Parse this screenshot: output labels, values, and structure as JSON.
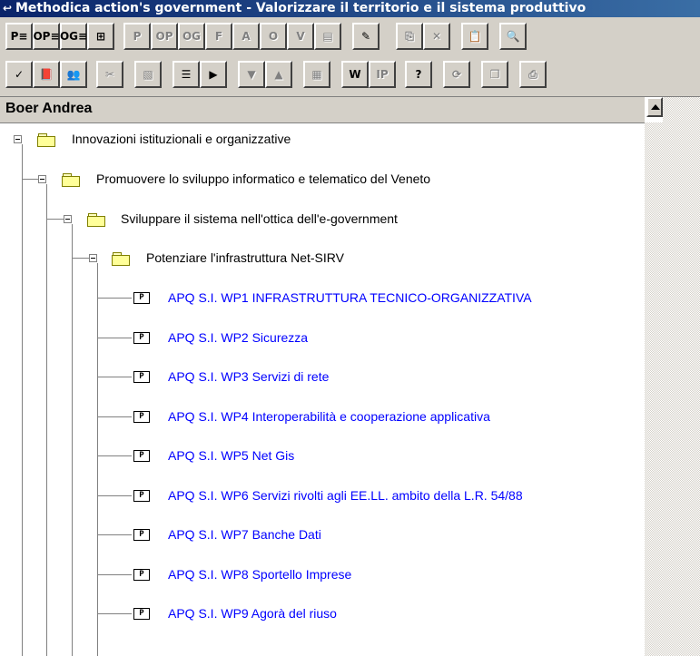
{
  "window": {
    "title": "Methodica action's government - Valorizzare il territorio e il sistema produttivo"
  },
  "toolbar1": [
    {
      "name": "pe-button",
      "glyph": "P≡"
    },
    {
      "name": "ope-button",
      "glyph": "OP≡"
    },
    {
      "name": "oge-button",
      "glyph": "OG≡"
    },
    {
      "name": "tree-view-button",
      "glyph": "⊞"
    },
    {
      "name": "p-button",
      "glyph": "P"
    },
    {
      "name": "op-button",
      "glyph": "OP"
    },
    {
      "name": "og-button",
      "glyph": "OG"
    },
    {
      "name": "f-button",
      "glyph": "F"
    },
    {
      "name": "a-button",
      "glyph": "A"
    },
    {
      "name": "o-button",
      "glyph": "O"
    },
    {
      "name": "v-button",
      "glyph": "V"
    },
    {
      "name": "document-button",
      "glyph": "▤"
    },
    {
      "name": "edit-button",
      "glyph": "✎"
    },
    {
      "name": "copy-button",
      "glyph": "⎘"
    },
    {
      "name": "delete-button",
      "glyph": "✕"
    },
    {
      "name": "paste-button",
      "glyph": "📋"
    },
    {
      "name": "search-button",
      "glyph": "🔍"
    }
  ],
  "toolbar2": [
    {
      "name": "check-button",
      "glyph": "✓"
    },
    {
      "name": "book-button",
      "glyph": "📕"
    },
    {
      "name": "users-button",
      "glyph": "👥"
    },
    {
      "name": "cut-button",
      "glyph": "✂"
    },
    {
      "name": "note-button",
      "glyph": "▧"
    },
    {
      "name": "list-button",
      "glyph": "☰"
    },
    {
      "name": "next-button",
      "glyph": "▶"
    },
    {
      "name": "move-down-button",
      "glyph": "▼"
    },
    {
      "name": "move-up-button",
      "glyph": "▲"
    },
    {
      "name": "calculator-button",
      "glyph": "▦"
    },
    {
      "name": "word-button",
      "glyph": "W"
    },
    {
      "name": "ip-button",
      "glyph": "IP"
    },
    {
      "name": "help-button",
      "glyph": "?"
    },
    {
      "name": "refresh-button",
      "glyph": "⟳"
    },
    {
      "name": "windows-button",
      "glyph": "❐"
    },
    {
      "name": "print-button",
      "glyph": "⎙"
    }
  ],
  "panel": {
    "header": "Boer Andrea"
  },
  "tree": {
    "level1": {
      "label": "Innovazioni istituzionali e organizzative"
    },
    "level2": {
      "label": "Promuovere lo sviluppo informatico e telematico del Veneto"
    },
    "level3": {
      "label": "Sviluppare il sistema nell'ottica dell'e-government"
    },
    "level4": {
      "label": "Potenziare l'infrastruttura Net-SIRV"
    },
    "projects": [
      {
        "icon": "P",
        "label": "APQ S.I. WP1 INFRASTRUTTURA TECNICO-ORGANIZZATIVA"
      },
      {
        "icon": "P",
        "label": "APQ S.I. WP2 Sicurezza"
      },
      {
        "icon": "P",
        "label": "APQ S.I. WP3 Servizi di rete"
      },
      {
        "icon": "P",
        "label": "APQ S.I. WP4 Interoperabilità e cooperazione applicativa"
      },
      {
        "icon": "P",
        "label": "APQ S.I. WP5 Net Gis"
      },
      {
        "icon": "P",
        "label": "APQ S.I. WP6 Servizi rivolti agli EE.LL. ambito della L.R. 54/88"
      },
      {
        "icon": "P",
        "label": "APQ S.I. WP7 Banche Dati"
      },
      {
        "icon": "P",
        "label": "APQ S.I. WP8 Sportello Imprese"
      },
      {
        "icon": "P",
        "label": "APQ S.I. WP9 Agorà del riuso"
      }
    ]
  }
}
